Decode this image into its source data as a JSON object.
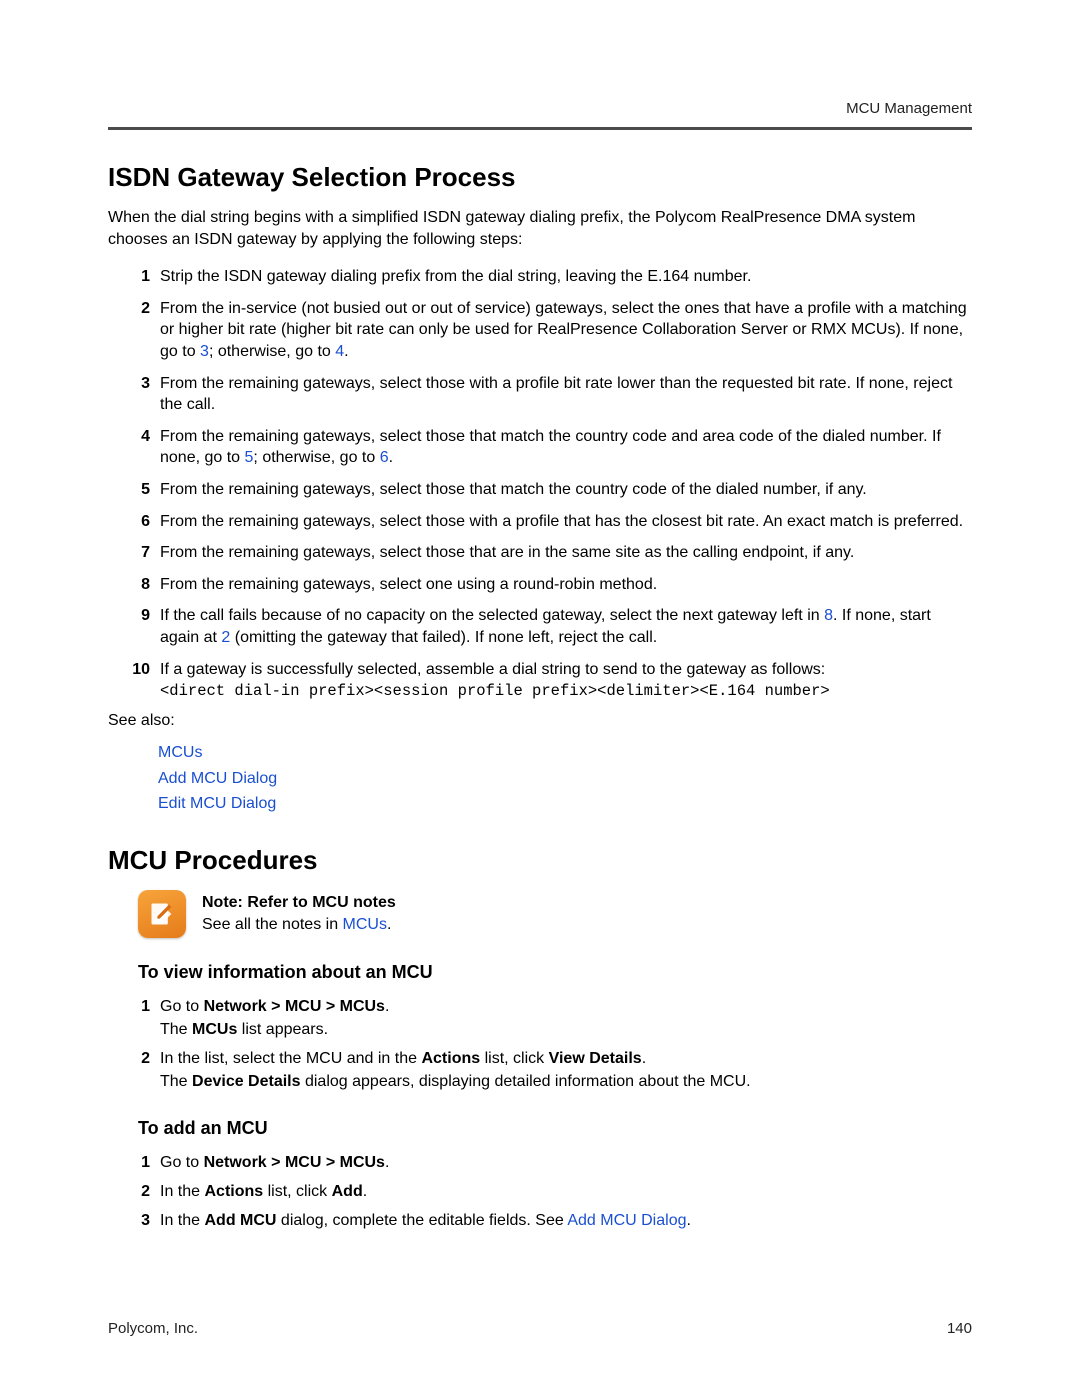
{
  "header": {
    "section": "MCU Management"
  },
  "isdn": {
    "title": "ISDN Gateway Selection Process",
    "intro": "When the dial string begins with a simplified ISDN gateway dialing prefix, the Polycom RealPresence DMA system chooses an ISDN gateway by applying the following steps:",
    "steps": {
      "s1": "Strip the ISDN gateway dialing prefix from the dial string, leaving the E.164 number.",
      "s2a": "From the in-service (not busied out or out of service) gateways, select the ones that have a profile with a matching or higher bit rate (higher bit rate can only be used for RealPresence Collaboration Server or RMX MCUs). If none, go to ",
      "s2_link1": "3",
      "s2b": "; otherwise, go to ",
      "s2_link2": "4",
      "s2c": ".",
      "s3": "From the remaining gateways, select those with a profile bit rate lower than the requested bit rate. If none, reject the call.",
      "s4a": "From the remaining gateways, select those that match the country code and area code of the dialed number. If none, go to ",
      "s4_link1": "5",
      "s4b": "; otherwise, go to ",
      "s4_link2": "6",
      "s4c": ".",
      "s5": "From the remaining gateways, select those that match the country code of the dialed number, if any.",
      "s6": "From the remaining gateways, select those with a profile that has the closest bit rate. An exact match is preferred.",
      "s7": "From the remaining gateways, select those that are in the same site as the calling endpoint, if any.",
      "s8": "From the remaining gateways, select one using a round-robin method.",
      "s9a": "If the call fails because of no capacity on the selected gateway, select the next gateway left in ",
      "s9_link1": "8",
      "s9b": ". If none, start again at ",
      "s9_link2": "2",
      "s9c": " (omitting the gateway that failed). If none left, reject the call.",
      "s10a": "If a gateway is successfully selected, assemble a dial string to send to the gateway as follows:",
      "s10_code": "<direct dial-in prefix><session profile prefix><delimiter><E.164 number>"
    }
  },
  "seeAlso": {
    "label": "See also:",
    "links": {
      "l1": "MCUs",
      "l2": "Add MCU Dialog",
      "l3": "Edit MCU Dialog"
    }
  },
  "procedures": {
    "title": "MCU Procedures",
    "note": {
      "title": "Note: Refer to MCU notes",
      "text_a": "See all the notes in ",
      "link": "MCUs",
      "text_b": "."
    },
    "view": {
      "title": "To view information about an MCU",
      "s1a": "Go to ",
      "s1b": "Network > MCU > MCUs",
      "s1c": ".",
      "s1d_a": "The ",
      "s1d_b": "MCUs",
      "s1d_c": " list appears.",
      "s2a": "In the list, select the MCU and in the ",
      "s2b": "Actions",
      "s2c": " list, click ",
      "s2d": "View Details",
      "s2e": ".",
      "s2f_a": "The ",
      "s2f_b": "Device Details",
      "s2f_c": " dialog appears, displaying detailed information about the MCU."
    },
    "add": {
      "title": "To add an MCU",
      "s1a": "Go to ",
      "s1b": "Network > MCU > MCUs",
      "s1c": ".",
      "s2a": "In the ",
      "s2b": "Actions",
      "s2c": " list, click ",
      "s2d": "Add",
      "s2e": ".",
      "s3a": "In the ",
      "s3b": "Add MCU",
      "s3c": " dialog, complete the editable fields. See ",
      "s3_link": "Add MCU Dialog",
      "s3d": "."
    }
  },
  "footer": {
    "company": "Polycom, Inc.",
    "page": "140"
  }
}
